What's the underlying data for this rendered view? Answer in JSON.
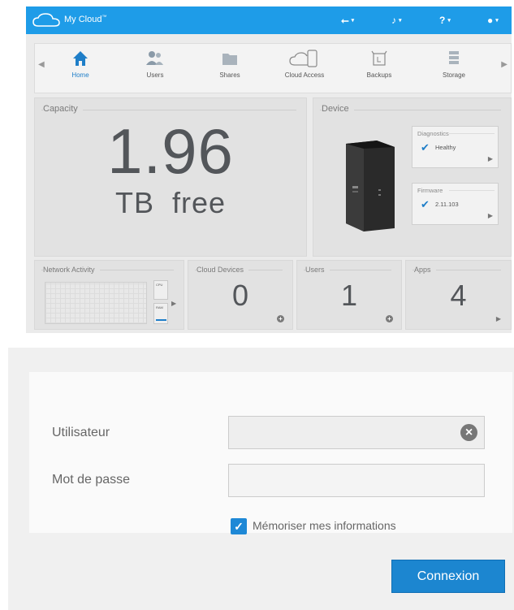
{
  "topbar": {
    "app_title": "My Cloud",
    "brand_color": "#1e9ce8",
    "icons": [
      "usb-icon",
      "bell-icon",
      "help-icon",
      "user-icon"
    ]
  },
  "nav": {
    "items": [
      {
        "label": "Home",
        "icon": "home-icon",
        "active": true
      },
      {
        "label": "Users",
        "icon": "users-icon"
      },
      {
        "label": "Shares",
        "icon": "folder-icon"
      },
      {
        "label": "Cloud Access",
        "icon": "cloud-device-icon"
      },
      {
        "label": "Backups",
        "icon": "backup-icon"
      },
      {
        "label": "Storage",
        "icon": "storage-icon"
      }
    ]
  },
  "capacity": {
    "title": "Capacity",
    "value": "1.96",
    "unit": "TB  free"
  },
  "device": {
    "title": "Device",
    "diagnostics": {
      "title": "Diagnostics",
      "value": "Healthy"
    },
    "firmware": {
      "title": "Firmware",
      "value": "2.11.103"
    }
  },
  "tiles": {
    "network": {
      "title": "Network Activity",
      "cpu_label": "CPU",
      "ram_label": "RAM"
    },
    "cloud_devices": {
      "title": "Cloud Devices",
      "count": "0"
    },
    "users": {
      "title": "Users",
      "count": "1"
    },
    "apps": {
      "title": "Apps",
      "count": "4"
    }
  },
  "login": {
    "user_label": "Utilisateur",
    "password_label": "Mot de passe",
    "user_value": "",
    "password_value": "",
    "remember_label": "Mémoriser mes informations",
    "remember_checked": true,
    "submit_label": "Connexion",
    "accent_color": "#1c86d0"
  }
}
